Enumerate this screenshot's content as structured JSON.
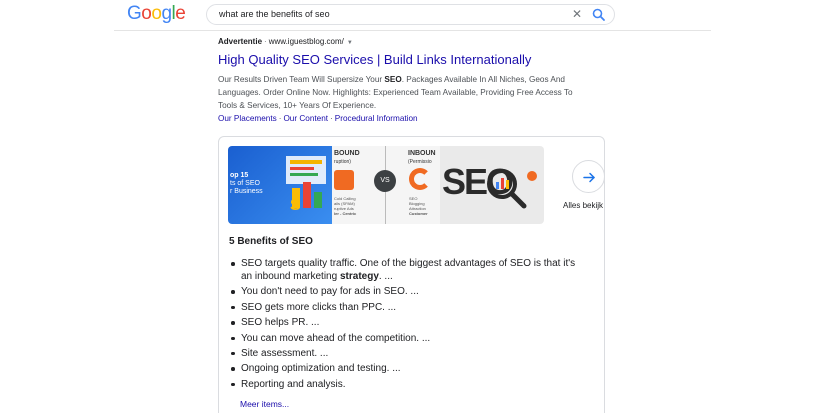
{
  "logo": {
    "letters": [
      "G",
      "o",
      "o",
      "g",
      "l",
      "e"
    ],
    "colors": [
      "#4285f4",
      "#ea4335",
      "#fbbc05",
      "#4285f4",
      "#34a853",
      "#ea4335"
    ]
  },
  "search": {
    "query": "what are the benefits of seo",
    "clear_icon": "close-icon",
    "search_icon": "magnifier-icon"
  },
  "ad": {
    "label": "Advertentie",
    "url": "www.iguestblog.com/",
    "title": "High Quality SEO Services | Build Links Internationally",
    "desc_part1": "Our Results Driven Team Will Supersize Your ",
    "desc_bold": "SEO",
    "desc_part2": ". Packages Available In All Niches, Geos And Languages. Order Online Now. Highlights: Experienced Team Available, Providing Free Access To Tools & Services, 10+ Years Of Experience.",
    "links": [
      "Our Placements",
      "Our Content",
      "Procedural Information"
    ]
  },
  "snippet": {
    "images": {
      "img1_text": [
        "op 15",
        "ts of SEO",
        "r Business"
      ],
      "img2_left": [
        "BOUND",
        "ruption)"
      ],
      "img2_vs": "VS",
      "img2_right": [
        "INBOUN",
        "(Permissio"
      ],
      "img2_small_left": [
        "Cold Calling",
        "ails (SPAM)",
        "ruptive Ads",
        "ler - Centric"
      ],
      "img2_small_right": [
        "SEO",
        "Blogging",
        "Attraction",
        "Customer"
      ],
      "img3_text": "SEO"
    },
    "see_all": "Alles bekijk",
    "title": "5 Benefits of SEO",
    "items": [
      {
        "text": "SEO targets quality traffic. One of the biggest advantages of SEO is that it's an inbound marketing ",
        "bold": "strategy",
        "tail": ". ..."
      },
      {
        "text": "You don't need to pay for ads in SEO. ..."
      },
      {
        "text": "SEO gets more clicks than PPC. ..."
      },
      {
        "text": "SEO helps PR. ..."
      },
      {
        "text": "You can move ahead of the competition. ..."
      },
      {
        "text": "Site assessment. ..."
      },
      {
        "text": "Ongoing optimization and testing. ..."
      },
      {
        "text": "Reporting and analysis."
      }
    ],
    "more": "Meer items..."
  }
}
